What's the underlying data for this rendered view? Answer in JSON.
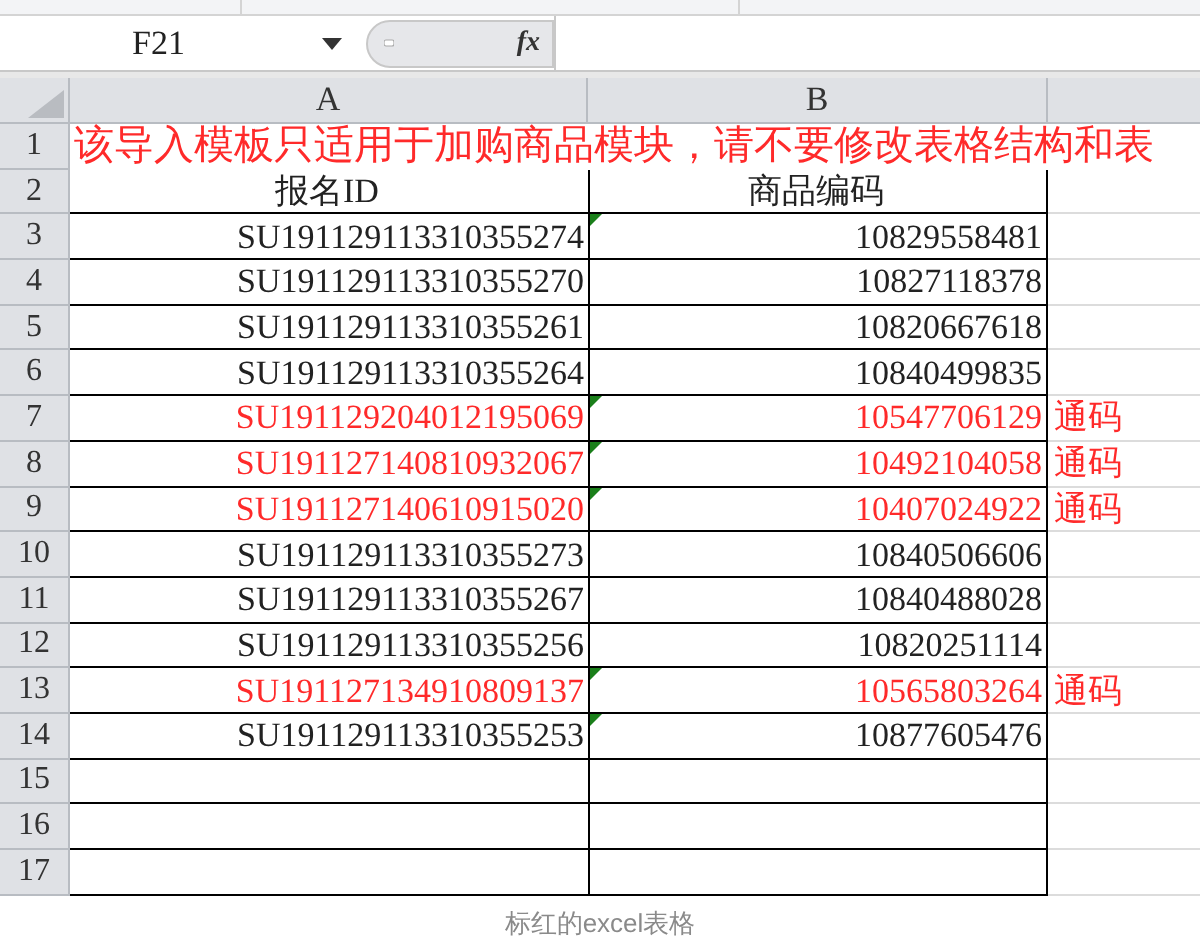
{
  "name_box": {
    "value": "F21"
  },
  "formula_button": "fx",
  "columns": [
    "A",
    "B"
  ],
  "rows": [
    {
      "number": "1",
      "kind": "title",
      "red": true,
      "cells": [
        "该导入模板只适用于加购商品模块，请不要修改表格结构和表"
      ]
    },
    {
      "number": "2",
      "kind": "header",
      "red": false,
      "marker": false,
      "cells": [
        "报名ID",
        "商品编码"
      ]
    },
    {
      "number": "3",
      "kind": "data",
      "red": false,
      "marker": true,
      "cells": [
        "SU191129113310355274",
        "10829558481"
      ]
    },
    {
      "number": "4",
      "kind": "data",
      "red": false,
      "marker": false,
      "cells": [
        "SU191129113310355270",
        "10827118378"
      ]
    },
    {
      "number": "5",
      "kind": "data",
      "red": false,
      "marker": false,
      "cells": [
        "SU191129113310355261",
        "10820667618"
      ]
    },
    {
      "number": "6",
      "kind": "data",
      "red": false,
      "marker": false,
      "cells": [
        "SU191129113310355264",
        "10840499835"
      ]
    },
    {
      "number": "7",
      "kind": "data",
      "red": true,
      "marker": true,
      "cells": [
        "SU191129204012195069",
        "10547706129",
        "通码"
      ]
    },
    {
      "number": "8",
      "kind": "data",
      "red": true,
      "marker": true,
      "cells": [
        "SU191127140810932067",
        "10492104058",
        "通码"
      ]
    },
    {
      "number": "9",
      "kind": "data",
      "red": true,
      "marker": true,
      "cells": [
        "SU191127140610915020",
        "10407024922",
        "通码"
      ]
    },
    {
      "number": "10",
      "kind": "data",
      "red": false,
      "marker": false,
      "cells": [
        "SU191129113310355273",
        "10840506606"
      ]
    },
    {
      "number": "11",
      "kind": "data",
      "red": false,
      "marker": false,
      "cells": [
        "SU191129113310355267",
        "10840488028"
      ]
    },
    {
      "number": "12",
      "kind": "data",
      "red": false,
      "marker": false,
      "cells": [
        "SU191129113310355256",
        "10820251114"
      ]
    },
    {
      "number": "13",
      "kind": "data",
      "red": true,
      "marker": true,
      "cells": [
        "SU191127134910809137",
        "10565803264",
        "通码"
      ]
    },
    {
      "number": "14",
      "kind": "data",
      "red": false,
      "marker": true,
      "cells": [
        "SU191129113310355253",
        "10877605476"
      ]
    },
    {
      "number": "15",
      "kind": "empty",
      "marker": false,
      "cells": []
    },
    {
      "number": "16",
      "kind": "empty",
      "marker": false,
      "cells": []
    },
    {
      "number": "17",
      "kind": "empty",
      "marker": false,
      "cells": []
    }
  ],
  "caption": "标红的excel表格"
}
